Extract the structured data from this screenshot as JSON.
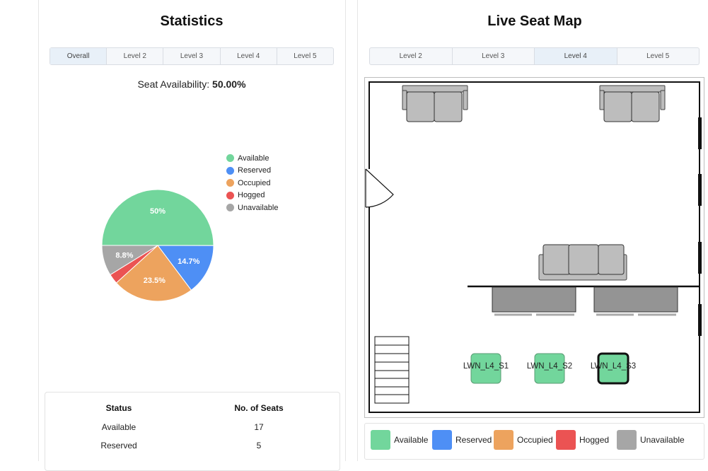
{
  "stats": {
    "title": "Statistics",
    "tabs": [
      "Overall",
      "Level 2",
      "Level 3",
      "Level 4",
      "Level 5"
    ],
    "active_tab": 0,
    "availability_label": "Seat Availability:",
    "availability_value": "50.00%"
  },
  "chart_data": {
    "type": "pie",
    "slices": [
      {
        "label": "Available",
        "value": 50.0,
        "text": "50%",
        "color": "#72d69c"
      },
      {
        "label": "Reserved",
        "value": 14.7,
        "text": "14.7%",
        "color": "#4e8ff5"
      },
      {
        "label": "Occupied",
        "value": 23.5,
        "text": "23.5%",
        "color": "#eda35e"
      },
      {
        "label": "Hogged",
        "value": 2.9,
        "text": "",
        "color": "#eb5353"
      },
      {
        "label": "Unavailable",
        "value": 8.8,
        "text": "8.8%",
        "color": "#a6a6a6"
      }
    ],
    "legend_placement": "right"
  },
  "table": {
    "headers": [
      "Status",
      "No. of Seats"
    ],
    "rows": [
      {
        "status": "Available",
        "count": "17"
      },
      {
        "status": "Reserved",
        "count": "5"
      }
    ]
  },
  "map": {
    "title": "Live Seat Map",
    "tabs": [
      "Level 2",
      "Level 3",
      "Level 4",
      "Level 5"
    ],
    "active_tab": 2,
    "seats": [
      {
        "label": "LWN_L4_S1",
        "status": "Available"
      },
      {
        "label": "LWN_L4_S2",
        "status": "Available"
      },
      {
        "label": "LWN_L4_S3",
        "status": "Available",
        "selected": true
      }
    ]
  },
  "legend": [
    {
      "label": "Available",
      "color": "#72d69c"
    },
    {
      "label": "Reserved",
      "color": "#4e8ff5"
    },
    {
      "label": "Occupied",
      "color": "#eda35e"
    },
    {
      "label": "Hogged",
      "color": "#eb5353"
    },
    {
      "label": "Unavailable",
      "color": "#a6a6a6"
    }
  ]
}
